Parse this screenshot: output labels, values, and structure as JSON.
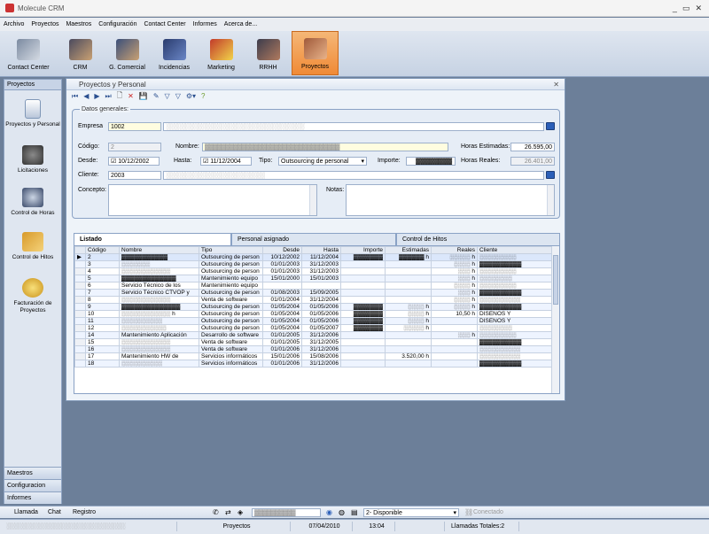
{
  "app": {
    "title": "Molecule CRM"
  },
  "menu": [
    "Archivo",
    "Proyectos",
    "Maestros",
    "Configuración",
    "Contact Center",
    "Informes",
    "Acerca de..."
  ],
  "ribbon": [
    {
      "label": "Contact Center",
      "icon": "contact-center-icon"
    },
    {
      "label": "CRM",
      "icon": "crm-people-icon"
    },
    {
      "label": "G. Comercial",
      "icon": "commercial-management-icon"
    },
    {
      "label": "Incidencias",
      "icon": "truck-incidents-icon"
    },
    {
      "label": "Marketing",
      "icon": "marketing-monitor-icon"
    },
    {
      "label": "RRHH",
      "icon": "human-resources-icon"
    },
    {
      "label": "Proyectos",
      "icon": "projects-building-icon"
    }
  ],
  "left_panel": {
    "header": "Proyectos",
    "items": [
      {
        "label": "Proyectos y Personal",
        "icon": "projects-staff-icon"
      },
      {
        "label": "Licitaciones",
        "icon": "tenders-icon"
      },
      {
        "label": "Control de Horas",
        "icon": "hours-control-icon"
      },
      {
        "label": "Control de Hitos",
        "icon": "milestones-icon"
      },
      {
        "label": "Facturación de Proyectos",
        "icon": "billing-coins-icon"
      }
    ],
    "bottom": [
      "Maestros",
      "Configuracion",
      "Informes"
    ]
  },
  "window": {
    "title": "Proyectos y Personal"
  },
  "form": {
    "section_title": "Datos generales:",
    "empresa_label": "Empresa",
    "empresa_value": "1002",
    "empresa_name": "░░░░░░░░░░░░░░░░░░░░░░░░░░░░░░░░░░░",
    "codigo_label": "Código:",
    "codigo_value": "2",
    "nombre_label": "Nombre:",
    "nombre_value": "▓▓▓▓▓▓▓▓▓▓▓▓▓▓▓▓▓▓▓▓▓▓▓▓▓▓▓▓▓▓▓▓▓",
    "horas_est_label": "Horas Estimadas:",
    "horas_est_value": "26.595,00",
    "desde_label": "Desde:",
    "desde_value": "10/12/2002",
    "hasta_label": "Hasta:",
    "hasta_value": "11/12/2004",
    "tipo_label": "Tipo:",
    "tipo_value": "Outsourcing de personal",
    "importe_label": "Importe:",
    "importe_value": "▓▓▓▓▓▓▓▓",
    "horas_reales_label": "Horas Reales:",
    "horas_reales_value": "26.401,00",
    "cliente_label": "Cliente:",
    "cliente_value": "2003",
    "cliente_name": "░░░░░░░░░░░░░░░░░░░░░░░░░",
    "concepto_label": "Concepto:",
    "notas_label": "Notas:"
  },
  "tabs": [
    "Listado",
    "Personal asignado",
    "Control de Hitos"
  ],
  "grid": {
    "columns": [
      "Código",
      "Nombre",
      "Tipo",
      "Desde",
      "Hasta",
      "Importe",
      "Estimadas",
      "Reales",
      "Cliente"
    ],
    "rows": [
      [
        "2",
        "▓▓▓▓▓▓▓▓▓▓▓",
        "Outsourcing de person",
        "10/12/2002",
        "11/12/2004",
        "▓▓▓▓▓▓▓",
        "▓▓▓▓▓▓ h",
        "░░░░░ h",
        "░░░░░░░░░"
      ],
      [
        "3",
        "░░░░░░░",
        "Outsourcing de person",
        "01/01/2003",
        "31/12/2003",
        "",
        "",
        "░░░░ h",
        "▓▓▓▓▓▓▓▓▓▓"
      ],
      [
        "4",
        "░░░░░░░░░░░░",
        "Outsourcing de person",
        "01/01/2003",
        "31/12/2003",
        "",
        "",
        "░░░ h",
        "░░░░░░░░░"
      ],
      [
        "5",
        "▓▓▓▓▓▓▓▓▓▓▓▓▓",
        "Mantenimiento equipo",
        "15/01/2000",
        "15/01/2003",
        "",
        "",
        "░░░ h",
        "░░░░░░░░"
      ],
      [
        "6",
        "Servicio Técnico de los",
        "Mantenimiento equipo",
        "",
        "",
        "",
        "",
        "░░░░ h",
        "░░░░░░░░░"
      ],
      [
        "7",
        "Servicio Técnico CTVOP y",
        "Outsourcing de person",
        "01/08/2003",
        "15/09/2005",
        "",
        "",
        "░░░ h",
        "▓▓▓▓▓▓▓▓▓▓"
      ],
      [
        "8",
        "░░░░░░░░░░░░",
        "Venta de software",
        "01/01/2004",
        "31/12/2004",
        "",
        "",
        "░░░░ h",
        "░░░░░░░░░░"
      ],
      [
        "9",
        "▓▓▓▓▓▓▓▓▓▓▓▓▓▓",
        "Outsourcing de person",
        "01/05/2004",
        "01/05/2006",
        "▓▓▓▓▓▓▓",
        "░░░░ h",
        "░░░░ h",
        "▓▓▓▓▓▓▓▓▓▓"
      ],
      [
        "10",
        "░░░░░░░░░░░░ h",
        "Outsourcing de person",
        "01/05/2004",
        "01/05/2006",
        "▓▓▓▓▓▓▓",
        "░░░░ h",
        "10,50 h",
        "DISEÑOS Y"
      ],
      [
        "11",
        "░░░░░░░░░░",
        "Outsourcing de person",
        "01/05/2004",
        "01/05/2006",
        "▓▓▓▓▓▓▓",
        "░░░░ h",
        "",
        "DISEÑOS Y"
      ],
      [
        "12",
        "░░░░░░░░░░░",
        "Outsourcing de person",
        "01/05/2004",
        "01/05/2007",
        "▓▓▓▓▓▓▓",
        "░░░░░ h",
        "",
        "░░░░░░░░"
      ],
      [
        "14",
        "Mantenimiento Aplicación",
        "Desarrollo de software",
        "01/01/2005",
        "31/12/2006",
        "",
        "",
        "░░░ h",
        "░░░░░░░░░"
      ],
      [
        "15",
        "░░░░░░░░░░░░",
        "Venta de software",
        "01/01/2005",
        "31/12/2005",
        "",
        "",
        "",
        "▓▓▓▓▓▓▓▓▓▓"
      ],
      [
        "16",
        "░░░░░░░░░░░░",
        "Venta de software",
        "01/01/2006",
        "31/12/2006",
        "",
        "",
        "",
        "░░░░░░░░░░"
      ],
      [
        "17",
        "Mantenimiento HW de",
        "Servicios informáticos",
        "15/01/2006",
        "15/08/2006",
        "",
        "3.520,00 h",
        "",
        "░░░░░░░░░░"
      ],
      [
        "18",
        "░░░░░░░░░░",
        "Servicios informáticos",
        "01/01/2006",
        "31/12/2006",
        "",
        "",
        "",
        "▓▓▓▓▓▓▓▓▓▓"
      ]
    ]
  },
  "status1": {
    "tabs": [
      "Llamada",
      "Chat",
      "Registro"
    ],
    "user_field": "▓▓▓▓▓▓▓▓▓▓",
    "availability": "2- Disponible",
    "connection": "Conectado"
  },
  "status2": {
    "user": "░░░░░░░░░░░░░░░░░░░░░░░░░░░░░░",
    "module": "Proyectos",
    "date": "07/04/2010",
    "time": "13:04",
    "calls_total": "Llamadas Totales:2"
  },
  "colors": {
    "accent_orange": "#f08a36",
    "brand_blue": "#2b5fb8",
    "panel_bg": "#dfe6f0"
  }
}
